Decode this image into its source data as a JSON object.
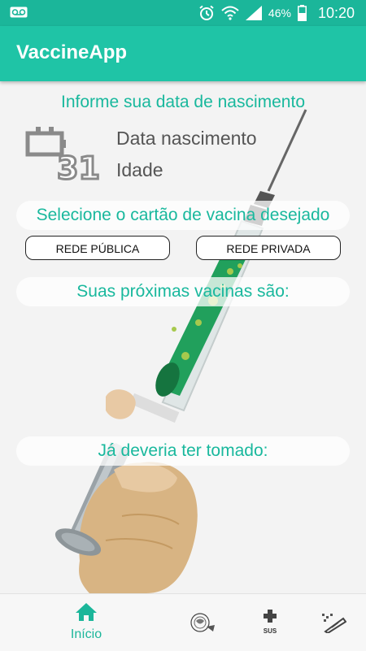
{
  "status_bar": {
    "battery_percent": "46%",
    "time": "10:20"
  },
  "app": {
    "title": "VaccineApp"
  },
  "birth_section": {
    "heading": "Informe sua data de nascimento",
    "calendar_number": "31",
    "birth_date_label": "Data nascimento",
    "age_label": "Idade"
  },
  "card_section": {
    "heading": "Selecione o cartão de vacina desejado",
    "public_button": "REDE PÚBLICA",
    "private_button": "REDE PRIVADA"
  },
  "upcoming_heading": "Suas próximas vacinas são:",
  "overdue_heading": "Já deveria ter tomado:",
  "bottom_nav": {
    "home_label": "Início",
    "sus_label": "SUS"
  },
  "colors": {
    "primary": "#1fc4a6",
    "status_bar": "#1bb69a",
    "accent_text": "#19b89d"
  }
}
